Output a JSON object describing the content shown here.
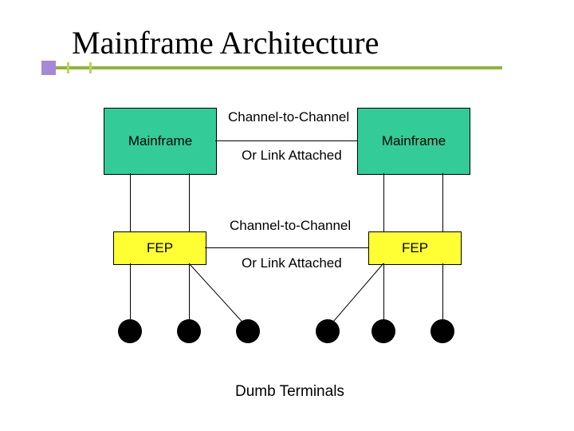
{
  "title": "Mainframe Architecture",
  "boxes": {
    "mainframe_left": "Mainframe",
    "mainframe_right": "Mainframe",
    "fep_left": "FEP",
    "fep_right": "FEP"
  },
  "links": {
    "top_label1": "Channel-to-Channel",
    "top_label2": "Or Link Attached",
    "bottom_label1": "Channel-to-Channel",
    "bottom_label2": "Or Link Attached"
  },
  "caption": "Dumb Terminals",
  "colors": {
    "accent_line": "#8db53a",
    "accent_square": "#a48ad6",
    "mainframe_fill": "#33cc99",
    "fep_fill": "#ffff33",
    "terminal_fill": "#000000"
  }
}
